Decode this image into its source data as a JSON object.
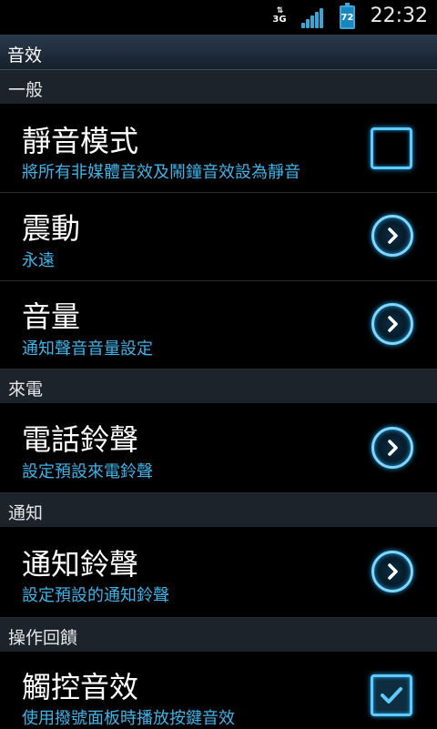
{
  "statusbar": {
    "network": "3G",
    "battery": "72",
    "time": "22:32",
    "icons": [
      "data-arrows-icon",
      "signal-icon",
      "battery-icon"
    ]
  },
  "header": {
    "title": "音效"
  },
  "sections": {
    "general": "一般",
    "incoming": "來電",
    "notification": "通知",
    "feedback": "操作回饋"
  },
  "items": {
    "silent": {
      "title": "靜音模式",
      "subtitle": "將所有非媒體音效及鬧鐘音效設為靜音",
      "checked": false
    },
    "vibrate": {
      "title": "震動",
      "subtitle": "永遠"
    },
    "volume": {
      "title": "音量",
      "subtitle": "通知聲音音量設定"
    },
    "ringtone": {
      "title": "電話鈴聲",
      "subtitle": "設定預設來電鈴聲"
    },
    "notification_ringtone": {
      "title": "通知鈴聲",
      "subtitle": "設定預設的通知鈴聲"
    },
    "touch_sound": {
      "title": "觸控音效",
      "subtitle": "使用撥號面板時播放按鍵音效",
      "checked": true
    }
  },
  "colors": {
    "accent": "#3fb4e8",
    "section_bg": "#1c232b",
    "title_bg": "#1f2d3b"
  }
}
